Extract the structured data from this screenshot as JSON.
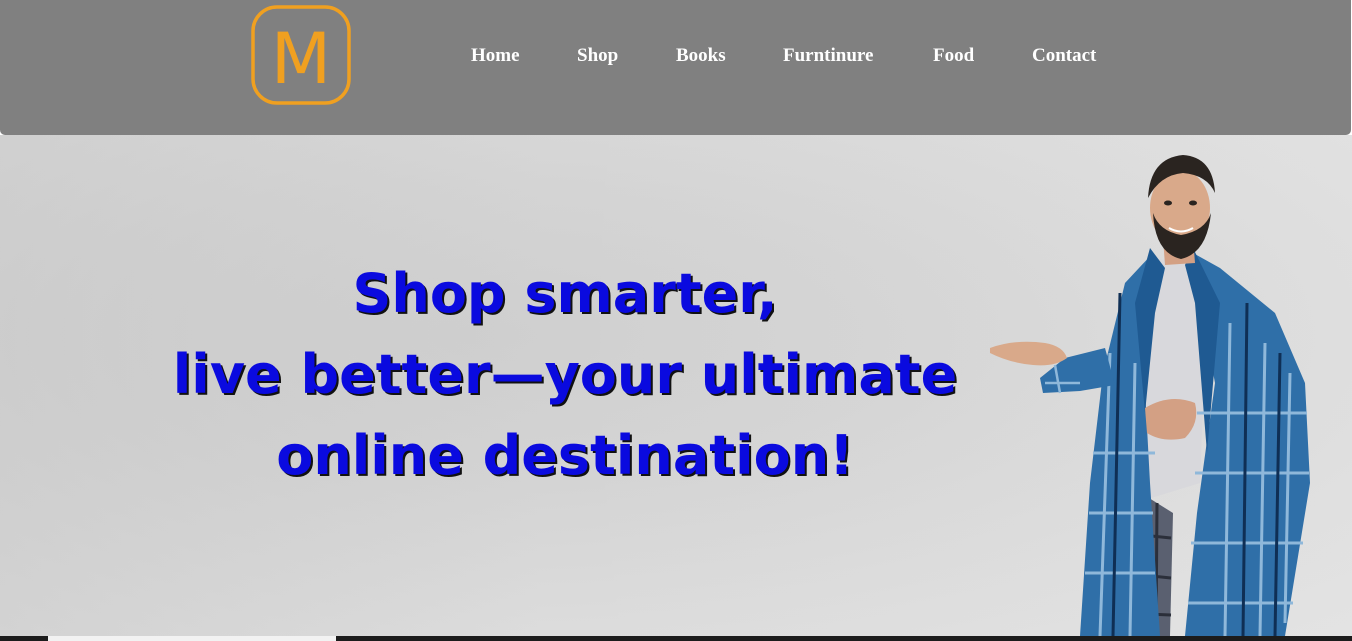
{
  "brand": {
    "logo_letter": "M",
    "logo_color": "#f0a020"
  },
  "nav": {
    "items": [
      {
        "label": "Home"
      },
      {
        "label": "Shop"
      },
      {
        "label": "Books"
      },
      {
        "label": "Furntinure"
      },
      {
        "label": "Food"
      },
      {
        "label": "Contact"
      }
    ]
  },
  "hero": {
    "headline_lines": [
      "Shop smarter,",
      "live better—your ultimate",
      "online destination!"
    ],
    "headline_color": "#0a0adf",
    "image": "man-in-blue-plaid-bathrobe-presenting"
  },
  "colors": {
    "navbar_bg": "#808080",
    "nav_text": "#ffffff"
  }
}
